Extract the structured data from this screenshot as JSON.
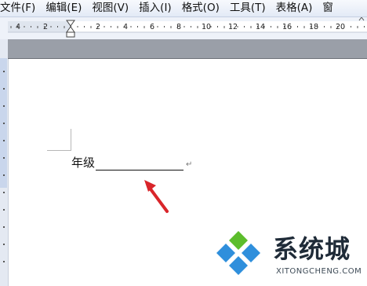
{
  "menubar": {
    "items": [
      {
        "label": "文件(F)"
      },
      {
        "label": "编辑(E)"
      },
      {
        "label": "视图(V)"
      },
      {
        "label": "插入(I)"
      },
      {
        "label": "格式(O)"
      },
      {
        "label": "工具(T)"
      },
      {
        "label": "表格(A)"
      },
      {
        "label": "窗"
      }
    ]
  },
  "ruler": {
    "numbers": [
      "4",
      "2",
      "2",
      "4",
      "6",
      "8",
      "10",
      "12",
      "14",
      "16",
      "18",
      "20"
    ]
  },
  "document": {
    "grade_label": "年级",
    "paragraph_mark": "↵"
  },
  "watermark": {
    "title": "系统城",
    "domain": "XITONGCHENG.COM",
    "colors": {
      "blue": "#2f8fdc",
      "green": "#5cbd2c"
    }
  },
  "annotation": {
    "arrow_color": "#d9252a"
  }
}
